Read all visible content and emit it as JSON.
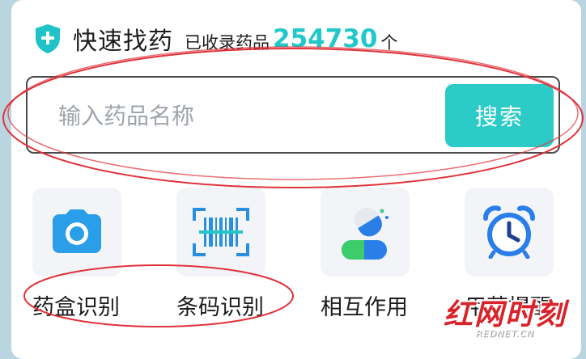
{
  "header": {
    "title": "快速找药",
    "sub_label": "已收录药品",
    "count": "254730",
    "unit": "个",
    "icon": "shield-plus-icon",
    "accent_color": "#22c8c9"
  },
  "search": {
    "placeholder": "输入药品名称",
    "value": "",
    "button_label": "搜索",
    "button_color": "#2ccbc7"
  },
  "features": [
    {
      "label": "药盒识别",
      "icon": "camera-icon"
    },
    {
      "label": "条码识别",
      "icon": "barcode-scan-icon"
    },
    {
      "label": "相互作用",
      "icon": "pills-icon"
    },
    {
      "label": "用药提醒",
      "icon": "alarm-clock-icon"
    }
  ],
  "watermark": {
    "text": "红网时刻",
    "sub": "REDNET.CN",
    "color": "#d8232a"
  },
  "annotation_color": "#e0323a"
}
